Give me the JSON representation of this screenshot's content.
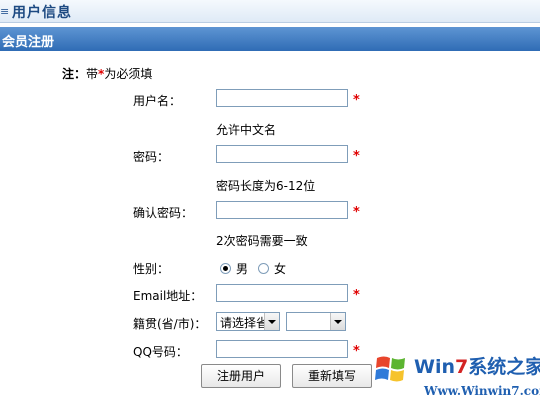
{
  "header": {
    "title": "用户信息"
  },
  "section": {
    "title": "会员注册"
  },
  "note": {
    "prefix": "注：",
    "text_before": "带",
    "star": "*",
    "text_after": "为必须填"
  },
  "form": {
    "username_label": "用户名：",
    "username_hint": "允许中文名",
    "password_label": "密码：",
    "password_hint": "密码长度为6-12位",
    "confirm_label": "确认密码：",
    "confirm_hint": "2次密码需要一致",
    "gender_label": "性别：",
    "gender_male": "男",
    "gender_female": "女",
    "email_label": "Email地址：",
    "origin_label": "籍贯(省/市)：",
    "province_value": "请选择省",
    "city_value": "",
    "qq_label": "QQ号码：",
    "required_mark": "*",
    "register_button": "注册用户",
    "reset_button": "重新填写"
  },
  "watermark": {
    "brand_prefix": "Win",
    "brand_seven": "7",
    "brand_suffix": "系统之家",
    "url": "Www.Winwin7.com"
  },
  "colors": {
    "section_bar": "#2f6cb5",
    "required": "#e00000",
    "input_border": "#7f9db9"
  }
}
